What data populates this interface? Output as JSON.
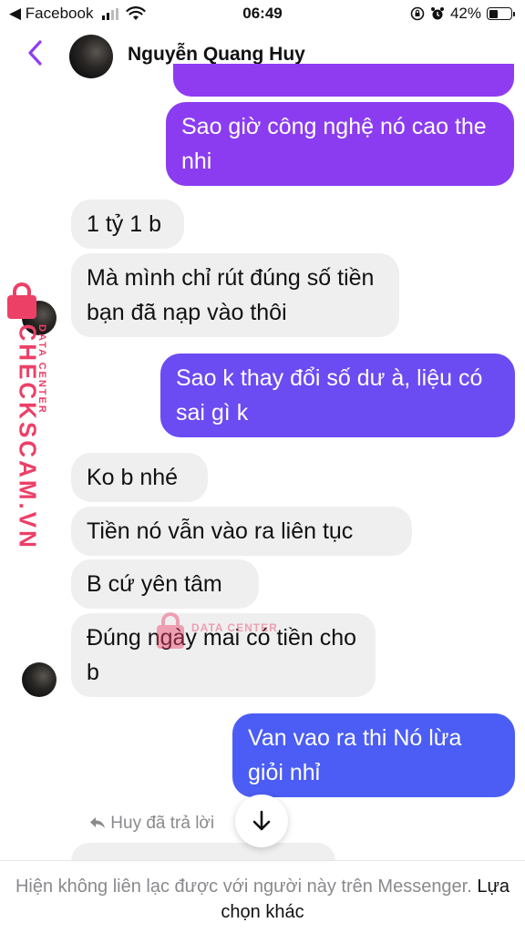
{
  "status_bar": {
    "back_app": "◀ Facebook",
    "time": "06:49",
    "battery": "42%",
    "battery_level": 0.42
  },
  "header": {
    "contact_name": "Nguyễn Quang Huy"
  },
  "watermark": {
    "brand": "CHECKSCAM.VN",
    "tag": "DATA CENTER"
  },
  "messages": [
    {
      "side": "out",
      "text": "Sao giờ công nghệ nó cao the nhi"
    },
    {
      "side": "in",
      "text": "1 tỷ 1 b"
    },
    {
      "side": "in",
      "text": "Mà mình chỉ rút đúng số tiền bạn đã nạp vào thôi"
    },
    {
      "side": "out",
      "text": "Sao k thay đổi số dư à, liệu có sai gì k"
    },
    {
      "side": "in",
      "text": "Ko b nhé"
    },
    {
      "side": "in",
      "text": "Tiền nó vẫn vào ra liên tục"
    },
    {
      "side": "in",
      "text": "B cứ yên tâm"
    },
    {
      "side": "in",
      "text": "Đúng ngày mai có tiền cho b"
    },
    {
      "side": "out",
      "text": "Van vao ra thi Nó lừa giỏi nhỉ"
    }
  ],
  "reply_note": "Huy đã trả lời",
  "footer": {
    "notice": "Hiện không liên lạc được với người này trên Messenger.",
    "alt_link": "Lựa chọn khác"
  },
  "colors": {
    "bubble_out_purple": "#8a3cf0",
    "bubble_out_indigo": "#6a4cf2",
    "bubble_out_blue": "#4a5cf5",
    "bubble_in": "#efeff0",
    "accent": "#8f3cf4",
    "watermark": "#ec4067"
  }
}
